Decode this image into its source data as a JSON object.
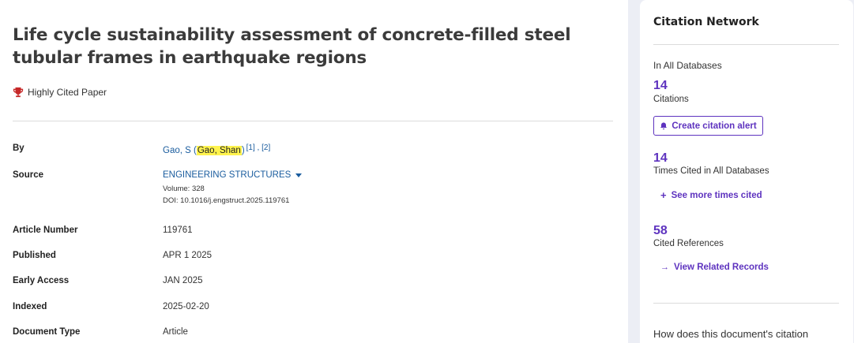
{
  "record": {
    "title": "Life cycle sustainability assessment of concrete-filled steel tubular frames in earthquake regions",
    "badge": "Highly Cited Paper",
    "fields": {
      "by_label": "By",
      "author_short": "Gao, S (",
      "author_full": "Gao, Shan",
      "author_close": ")",
      "affil_refs": "[1] , [2]",
      "source_label": "Source",
      "source_name": "ENGINEERING STRUCTURES",
      "volume": "Volume: 328",
      "doi": "DOI: 10.1016/j.engstruct.2025.119761",
      "article_number_label": "Article Number",
      "article_number": "119761",
      "published_label": "Published",
      "published": "APR 1 2025",
      "early_access_label": "Early Access",
      "early_access": "JAN 2025",
      "indexed_label": "Indexed",
      "indexed": "2025-02-20",
      "doc_type_label": "Document Type",
      "doc_type": "Article"
    }
  },
  "citation_network": {
    "title": "Citation Network",
    "db_label": "In All Databases",
    "citations_count": "14",
    "citations_label": "Citations",
    "alert_button": "Create citation alert",
    "times_cited_count": "14",
    "times_cited_label": "Times Cited in All Databases",
    "see_more": "See more times cited",
    "cited_refs_count": "58",
    "cited_refs_label": "Cited References",
    "related": "View Related Records",
    "bottom_text": "How does this document's citation"
  },
  "colors": {
    "accent": "#5e33bf",
    "link": "#1a5c9e",
    "highlight": "#fff34d",
    "trophy": "#c62828"
  },
  "icons": [
    "trophy-icon",
    "caret-down-icon",
    "bell-icon",
    "plus-icon",
    "arrow-right-icon"
  ]
}
